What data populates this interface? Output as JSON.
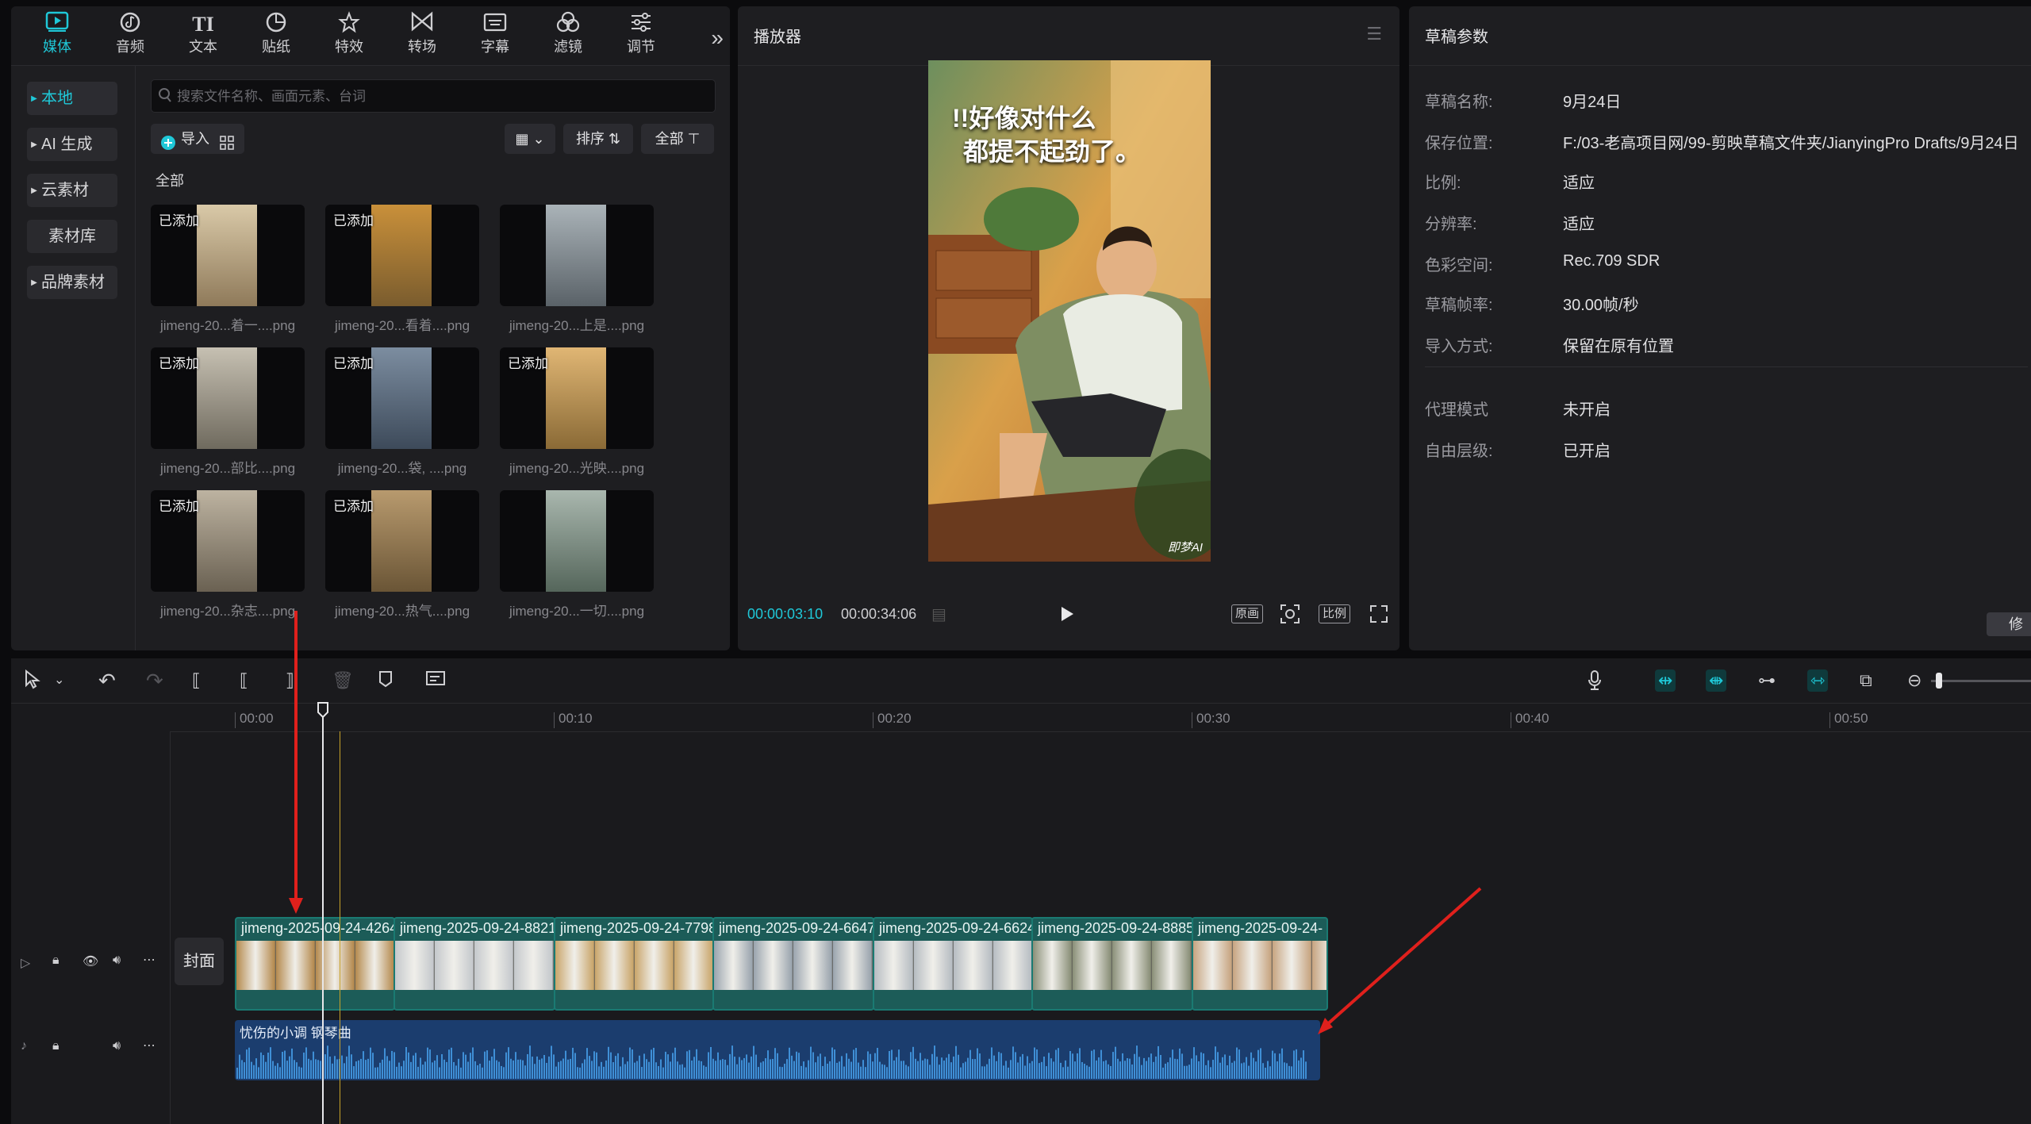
{
  "media_panel": {
    "tabs": [
      {
        "label": "媒体",
        "icon": "media-icon",
        "active": true
      },
      {
        "label": "音频",
        "icon": "audio-icon"
      },
      {
        "label": "文本",
        "icon": "text-icon"
      },
      {
        "label": "贴纸",
        "icon": "sticker-icon"
      },
      {
        "label": "特效",
        "icon": "effects-icon"
      },
      {
        "label": "转场",
        "icon": "transition-icon"
      },
      {
        "label": "字幕",
        "icon": "subtitle-icon"
      },
      {
        "label": "滤镜",
        "icon": "filter-icon"
      },
      {
        "label": "调节",
        "icon": "adjust-icon"
      }
    ],
    "sidebar": [
      {
        "label": "本地",
        "active": true,
        "caret": true
      },
      {
        "label": "AI 生成",
        "caret": true
      },
      {
        "label": "云素材",
        "caret": true
      },
      {
        "label": "素材库",
        "caret": false
      },
      {
        "label": "品牌素材",
        "caret": true
      }
    ],
    "search_placeholder": "搜索文件名称、画面元素、台词",
    "import_label": "导入",
    "sort_label": "排序",
    "filter_label": "全部",
    "section_label": "全部",
    "added_badge": "已添加",
    "items": [
      {
        "name": "jimeng-20...着一....png",
        "added": true
      },
      {
        "name": "jimeng-20...看着....png",
        "added": true
      },
      {
        "name": "jimeng-20...上是....png",
        "added": false
      },
      {
        "name": "jimeng-20...部比....png",
        "added": true
      },
      {
        "name": "jimeng-20...袋, ....png",
        "added": true
      },
      {
        "name": "jimeng-20...光映....png",
        "added": true
      },
      {
        "name": "jimeng-20...杂志....png",
        "added": true
      },
      {
        "name": "jimeng-20...热气....png",
        "added": true
      },
      {
        "name": "jimeng-20...一切....png",
        "added": false
      }
    ]
  },
  "player": {
    "title": "播放器",
    "caption_line1": "!!好像对什么",
    "caption_line2": "都提不起劲了。",
    "watermark": "即梦AI",
    "current_time": "00:00:03:10",
    "total_time": "00:00:34:06",
    "original_label": "原画",
    "ratio_label": "比例"
  },
  "draft": {
    "title": "草稿参数",
    "props": [
      {
        "label": "草稿名称:",
        "value": "9月24日"
      },
      {
        "label": "保存位置:",
        "value": "F:/03-老高项目网/99-剪映草稿文件夹/JianyingPro Drafts/9月24日"
      },
      {
        "label": "比例:",
        "value": "适应"
      },
      {
        "label": "分辨率:",
        "value": "适应"
      },
      {
        "label": "色彩空间:",
        "value": "Rec.709 SDR"
      },
      {
        "label": "草稿帧率:",
        "value": "30.00帧/秒"
      },
      {
        "label": "导入方式:",
        "value": "保留在原有位置"
      },
      {
        "label": "代理模式",
        "value": "未开启"
      },
      {
        "label": "自由层级:",
        "value": "已开启"
      }
    ],
    "modify_label": "修"
  },
  "timeline": {
    "ruler": [
      "00:00",
      "00:10",
      "00:20",
      "00:30",
      "00:40",
      "00:50"
    ],
    "cover_label": "封面",
    "clips": [
      "jimeng-2025-09-24-4264",
      "jimeng-2025-09-24-8821",
      "jimeng-2025-09-24-7798",
      "jimeng-2025-09-24-6647",
      "jimeng-2025-09-24-6624",
      "jimeng-2025-09-24-8885",
      "jimeng-2025-09-24-"
    ],
    "audio_name": "忧伤的小调 钢琴曲"
  },
  "colors": {
    "accent": "#1fc8d8",
    "video_clip": "#1c5c58",
    "audio_clip": "#1b3d6e",
    "annotation": "#e0201c"
  }
}
